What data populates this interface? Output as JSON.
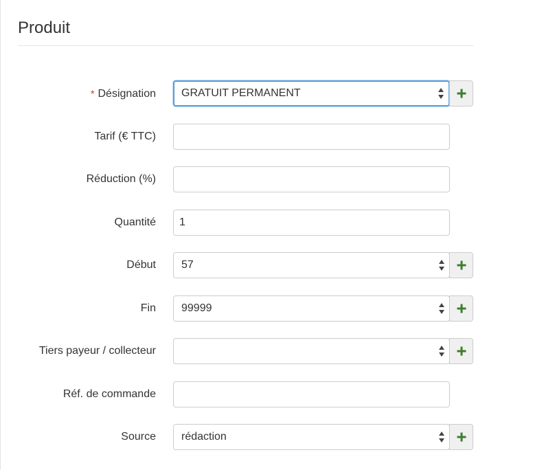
{
  "section": {
    "title": "Produit"
  },
  "form": {
    "designation": {
      "required_mark": "*",
      "label": "Désignation",
      "value": "GRATUIT PERMANENT"
    },
    "tarif": {
      "label": "Tarif (€ TTC)",
      "value": ""
    },
    "reduction": {
      "label": "Réduction (%)",
      "value": ""
    },
    "quantite": {
      "label": "Quantité",
      "value": "1"
    },
    "debut": {
      "label": "Début",
      "value": "57"
    },
    "fin": {
      "label": "Fin",
      "value": "99999"
    },
    "tiers": {
      "label": "Tiers payeur / collecteur",
      "value": ""
    },
    "ref_commande": {
      "label": "Réf. de commande",
      "value": ""
    },
    "source": {
      "label": "Source",
      "value": "rédaction"
    }
  },
  "colors": {
    "required": "#c9302c",
    "add_icon": "#3e7d2e",
    "focus_border": "#5b9dd9"
  },
  "icons": {
    "add": "plus-icon",
    "select_arrows": "select-arrows-icon"
  }
}
